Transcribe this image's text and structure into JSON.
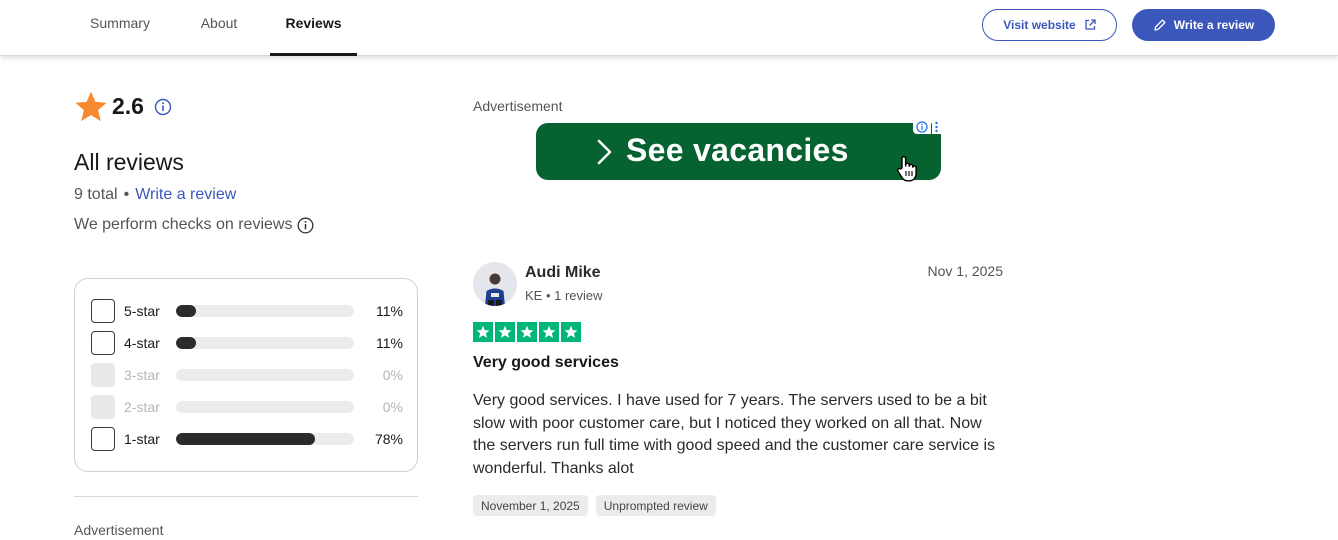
{
  "nav": {
    "tabs": [
      {
        "label": "Summary",
        "active": false
      },
      {
        "label": "About",
        "active": false
      },
      {
        "label": "Reviews",
        "active": true
      }
    ],
    "visit_website": "Visit website",
    "write_review": "Write a review"
  },
  "summary": {
    "rating": "2.6",
    "heading": "All reviews",
    "total": "9 total",
    "separator": "•",
    "write_link": "Write a review",
    "checks_text": "We perform checks on reviews"
  },
  "filters": [
    {
      "label": "5-star",
      "percent": "11%",
      "value": 0.11,
      "enabled": true
    },
    {
      "label": "4-star",
      "percent": "11%",
      "value": 0.11,
      "enabled": true
    },
    {
      "label": "3-star",
      "percent": "0%",
      "value": 0,
      "enabled": false
    },
    {
      "label": "2-star",
      "percent": "0%",
      "value": 0,
      "enabled": false
    },
    {
      "label": "1-star",
      "percent": "78%",
      "value": 0.78,
      "enabled": true
    }
  ],
  "left_ad_label": "Advertisement",
  "ad": {
    "label": "Advertisement",
    "banner_text": "See vacancies"
  },
  "review": {
    "name": "Audi Mike",
    "meta": "KE • 1 review",
    "date": "Nov 1, 2025",
    "stars": 5,
    "title": "Very good services",
    "body": "Very good services. I have used for 7 years. The servers used to be a bit slow with poor customer care, but I noticed they worked on all that. Now the servers run full time with good speed and the customer care service is wonderful. Thanks alot",
    "chips": [
      "November 1, 2025",
      "Unprompted review"
    ]
  },
  "colors": {
    "brand_blue": "#3c57bc",
    "star_orange": "#f58a2e",
    "trust_green": "#00b67a",
    "ad_green": "#066230"
  }
}
